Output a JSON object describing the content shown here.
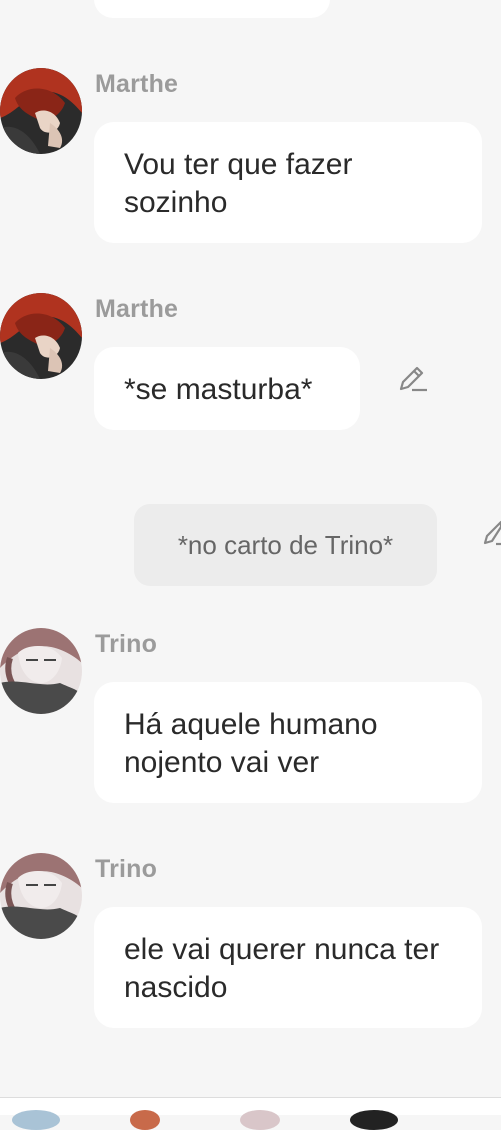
{
  "messages": [
    {
      "sender": "Marthe",
      "text": "Vou ter que fazer sozinho"
    },
    {
      "sender": "Marthe",
      "text": "*se masturba*"
    },
    {
      "sender": "Trino",
      "text": "Há aquele humano nojento vai ver"
    },
    {
      "sender": "Trino",
      "text": "ele vai querer nunca ter nascido"
    }
  ],
  "narration": {
    "text": "*no carto de Trino*"
  },
  "icons": {
    "edit": "pencil-icon",
    "avatar_marthe": "avatar-red-hair",
    "avatar_trino": "avatar-gray-hair"
  },
  "colors": {
    "background": "#f6f6f6",
    "bubble": "#ffffff",
    "narration_bubble": "#ececec",
    "name": "#9b9b9b"
  }
}
